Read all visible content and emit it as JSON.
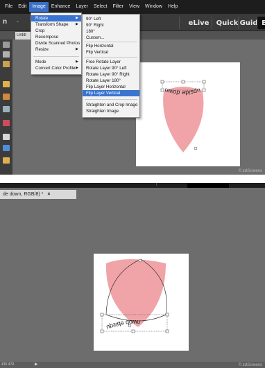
{
  "top": {
    "menubar": [
      "File",
      "Edit",
      "Image",
      "Enhance",
      "Layer",
      "Select",
      "Filter",
      "View",
      "Window",
      "Help"
    ],
    "active_menu": "Image",
    "mode_prefix": "n",
    "mode_arrow": "-",
    "modes": {
      "elive": "eLive",
      "quick": "Quick",
      "guided": "Guided",
      "expert": "E"
    },
    "doc_tab": "Untitl",
    "image_menu": {
      "group1": [
        "Rotate",
        "Transform Shape",
        "Crop",
        "Recompose",
        "Divide Scanned Photos",
        "Resize"
      ],
      "group2": [
        "Mode",
        "Convert Color Profile"
      ]
    },
    "rotate_menu": {
      "group1": [
        "90° Left",
        "90° Right",
        "180°",
        "Custom..."
      ],
      "group2": [
        "Flip Horizontal",
        "Flip Vertical"
      ],
      "group3": [
        "Free Rotate Layer",
        "Rotate Layer 90° Left",
        "Rotate Layer 90° Right",
        "Rotate Layer 180°",
        "Flip Layer Horizontal",
        "Flip Layer Vertical"
      ],
      "group4": [
        "Straighten and Crop Image",
        "Straighten Image"
      ]
    },
    "canvas_text": "upside down",
    "watermark": "© zdScreens"
  },
  "bottom": {
    "notch": "(",
    "doc_tab": "de down, RGB/8) *",
    "close": "×",
    "canvas_text": "upside down",
    "status_left": "415 479",
    "status_arrow": "▶",
    "watermark": "© zdScreens"
  },
  "colors": {
    "shape_fill": "#f0a4a8",
    "menu_highlight": "#3a74d1"
  }
}
